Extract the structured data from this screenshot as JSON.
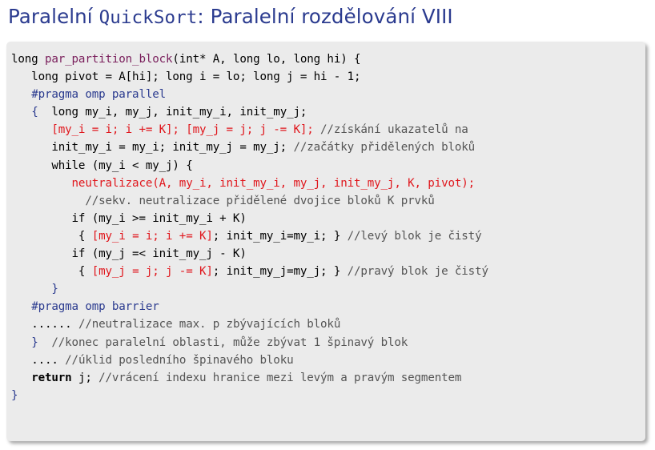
{
  "title": {
    "part1": "Paralelní ",
    "mono": "QuickSort",
    "part2": ": Paralelní rozdělování VIII"
  },
  "code": {
    "l1_a": "long ",
    "l1_fn": "par_partition_block",
    "l1_b": "(int* A, long lo, long hi) {",
    "l2": "   long pivot = A[hi]; long i = lo; long j = hi - 1;",
    "l3": "#pragma omp parallel",
    "l4_brace": "{",
    "l4_b": "  long my_i, my_j, init_my_i, init_my_j;",
    "l5_red": "[my_i = i; i += K]; [my_j = j; j -= K];",
    "l5_cm": " //získání ukazatelů na",
    "l6_a": "init_my_i = my_i; init_my_j = my_j; ",
    "l6_cm": "//začátky přidělených bloků",
    "l7": "while (my_i < my_j) {",
    "l8_red": "neutralizace(A, my_i, init_my_i, my_j, init_my_j, K, pivot);",
    "l9_cm": "//sekv. neutralizace přidělené dvojice bloků K prvků",
    "l10": "if (my_i >= init_my_i + K)",
    "l11_a": "{ ",
    "l11_red": "[my_i = i; i += K]",
    "l11_b": "; init_my_i=my_i; } ",
    "l11_cm": "//levý blok je čistý",
    "l12": "if (my_j =< init_my_j - K)",
    "l13_a": "{ ",
    "l13_red": "[my_j = j; j -= K]",
    "l13_b": "; init_my_j=my_j; } ",
    "l13_cm": "//pravý blok je čistý",
    "l14": "}",
    "l15": "#pragma omp barrier",
    "l16_a": "...... ",
    "l16_cm": "//neutralizace max. p zbývajících bloků",
    "l17_brace": "}",
    "l17_cm": "  //konec paralelní oblasti, může zbývat 1 špinavý blok",
    "l18_a": ".... ",
    "l18_cm": "//úklid posledního špinavého bloku",
    "l19_kw": "return",
    "l19_a": " j; ",
    "l19_cm": "//vrácení indexu hranice mezi levým a pravým segmentem",
    "l20": "}"
  }
}
